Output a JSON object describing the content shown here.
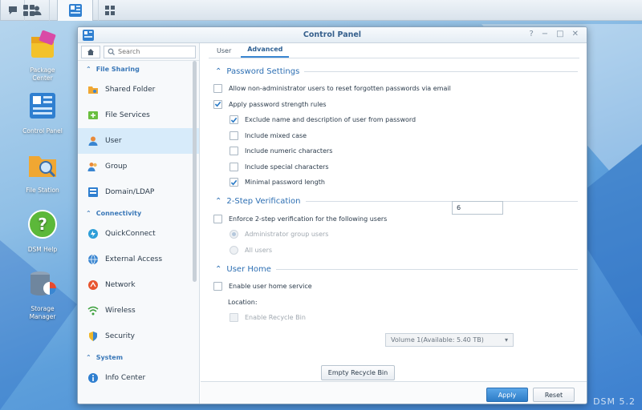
{
  "window": {
    "title": "Control Panel"
  },
  "desktop": {
    "icons": [
      {
        "label": "Package\nCenter"
      },
      {
        "label": "Control Panel"
      },
      {
        "label": "File Station"
      },
      {
        "label": "DSM Help"
      },
      {
        "label": "Storage\nManager"
      }
    ],
    "watermark": "DSM 5.2"
  },
  "sidebar": {
    "search_placeholder": "Search",
    "sections": {
      "file_sharing": "File Sharing",
      "connectivity": "Connectivity",
      "system": "System"
    },
    "items": {
      "shared_folder": "Shared Folder",
      "file_services": "File Services",
      "user": "User",
      "group": "Group",
      "domain_ldap": "Domain/LDAP",
      "quickconnect": "QuickConnect",
      "external_access": "External Access",
      "network": "Network",
      "wireless": "Wireless",
      "security": "Security",
      "info_center": "Info Center"
    }
  },
  "tabs": {
    "user": "User",
    "advanced": "Advanced"
  },
  "password_settings": {
    "title": "Password Settings",
    "allow_reset": "Allow non-administrator users to reset forgotten passwords via email",
    "apply_rules": "Apply password strength rules",
    "exclude_name": "Exclude name and description of user from password",
    "mixed_case": "Include mixed case",
    "numeric": "Include numeric characters",
    "special": "Include special characters",
    "min_length": "Minimal password length",
    "min_length_value": "6"
  },
  "two_step": {
    "title": "2-Step Verification",
    "enforce": "Enforce 2-step verification for the following users",
    "admin_group": "Administrator group users",
    "all_users": "All users"
  },
  "user_home": {
    "title": "User Home",
    "enable": "Enable user home service",
    "location_label": "Location:",
    "location_value": "Volume 1(Available: 5.40 TB)",
    "recycle_bin": "Enable Recycle Bin",
    "empty_recycle": "Empty Recycle Bin"
  },
  "footer": {
    "apply": "Apply",
    "reset": "Reset"
  },
  "colors": {
    "accent": "#2d7cc7",
    "heading": "#2d6fb3",
    "active_item": "#d7ebfa"
  }
}
